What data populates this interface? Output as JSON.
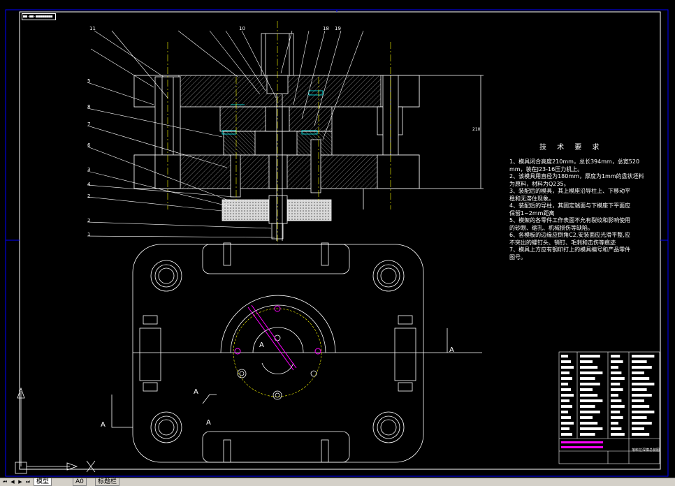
{
  "sheet": {
    "label": "■■-■■-■■■■■■■■"
  },
  "tech_requirements": {
    "title": "技 术 要 求",
    "lines": [
      "1、模具闭合高度210mm，总长394mm，总宽520",
      "mm，装在J23-16压力机上。",
      "2、该模具用直径为180mm，厚度为1mm的盘状坯料",
      "为原料，材料为Q235。",
      "3、装配后的模具，其上模座沿导柱上、下移动平",
      "稳和无滞住现象。",
      "4、装配后的导柱，其固定端面与下模座下平面应",
      "保留1~2mm距离",
      "5、模架的各零件工作表面不允有裂纹和影响使用",
      "的砂眼、缩孔、机械损伤等缺陷。",
      "6、各模板的边缘应倒角C2,安装面应光滑平整,应",
      "不突出的螺钉头、销钉、毛刺和击伤等痕迹",
      "7、模具上方应有钢印打上的模具编号和产品零件",
      "图号。"
    ]
  },
  "part_labels": [
    "11",
    "10",
    "18",
    "19",
    "5",
    "8",
    "7",
    "6",
    "3",
    "4",
    "2",
    "2",
    "1"
  ],
  "section_marks": [
    "A",
    "A",
    "A",
    "A",
    "A"
  ],
  "dimension": "210",
  "title_block": {
    "caption": "落料拉深模总装图"
  },
  "tabs": {
    "active": "模型",
    "items": [
      "模型",
      "A0",
      "标题栏"
    ]
  },
  "colors": {
    "background": "#000000",
    "border": "#0000ff",
    "lines": "#ffffff",
    "centerline": "#ffff00",
    "highlight": "#ff00ff",
    "hatch_fill": "#ffffff"
  }
}
